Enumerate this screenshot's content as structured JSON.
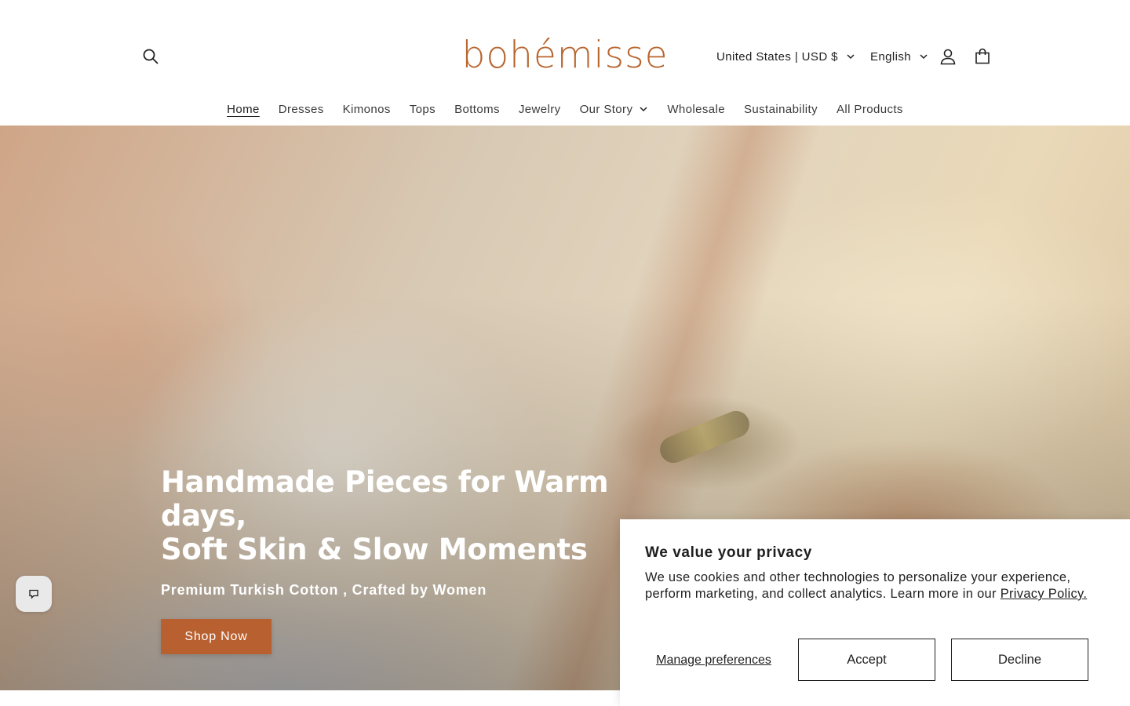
{
  "header": {
    "logo": "bohémisse",
    "country_selector": "United States | USD $",
    "language_selector": "English",
    "icons": {
      "search": "search-icon",
      "account": "user-icon",
      "cart": "shopping-bag-icon"
    }
  },
  "nav": {
    "items": [
      {
        "label": "Home",
        "active": true
      },
      {
        "label": "Dresses"
      },
      {
        "label": "Kimonos"
      },
      {
        "label": "Tops"
      },
      {
        "label": "Bottoms"
      },
      {
        "label": "Jewelry"
      },
      {
        "label": "Our Story",
        "has_dropdown": true
      },
      {
        "label": "Wholesale"
      },
      {
        "label": "Sustainability"
      },
      {
        "label": "All Products"
      }
    ]
  },
  "hero": {
    "title_line1": "Handmade Pieces for Warm days,",
    "title_line2": "Soft Skin & Slow Moments",
    "subtitle": "Premium Turkish Cotton , Crafted by Women",
    "cta": "Shop Now"
  },
  "chat": {
    "icon": "chat-bubble-icon"
  },
  "cookie_banner": {
    "title": "We value your privacy",
    "text": "We use cookies and other technologies to personalize your experience, perform marketing, and collect analytics. Learn more in our ",
    "link": "Privacy Policy.",
    "manage": "Manage preferences",
    "accept": "Accept",
    "decline": "Decline"
  },
  "colors": {
    "brand": "#b8652e",
    "cta_background": "#b8602f",
    "text": "#1f1f1f"
  }
}
